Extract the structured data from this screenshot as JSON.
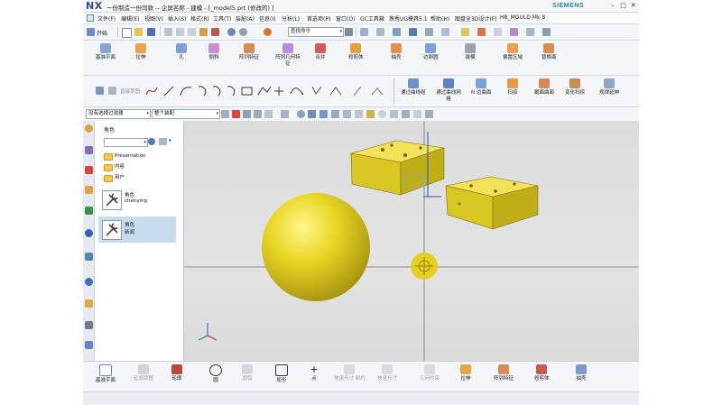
{
  "title_bar": {
    "logo": "NX",
    "title": "一份制造一份同款 -- 企屏名称 - 建模 - [_model5.prt  (修改的) ]",
    "brand": "SIEMENS",
    "minimize": "–",
    "restore": "□",
    "close": "✕"
  },
  "menu": [
    "文件(F)",
    "编辑(E)",
    "视图(V)",
    "插入(S)",
    "格式(R)",
    "工具(T)",
    "装配(A)",
    "信息(I)",
    "分析(L)",
    "首选项(P)",
    "窗口(O)",
    "GC工具箱",
    "燕秀UG模具5.1",
    "帮助(H)",
    "图盘全3D设计(F)",
    "HB_MOULD Mk 8"
  ],
  "toolbar1": {
    "start_label": "开始",
    "command_search_placeholder": "查找命令"
  },
  "toolbar2": [
    {
      "label": "基准平面",
      "icon": "datum-plane-icon",
      "color": "#8aa6cf"
    },
    {
      "label": "拉伸",
      "icon": "extrude-icon",
      "color": "#e7a24a"
    },
    {
      "label": "孔",
      "icon": "hole-icon",
      "color": "#7da0d6"
    },
    {
      "label": "倒斜",
      "icon": "chamfer-icon",
      "color": "#c98dd1"
    },
    {
      "label": "阵列特征",
      "icon": "pattern-feature-icon",
      "color": "#d88a58"
    },
    {
      "label": "阵列几何特征",
      "icon": "pattern-geometry-icon",
      "color": "#b68be0"
    },
    {
      "label": "合并",
      "icon": "unite-icon",
      "color": "#d85a58"
    },
    {
      "label": "修剪体",
      "icon": "trim-body-icon",
      "color": "#e0a146"
    },
    {
      "label": "抽壳",
      "icon": "shell-icon",
      "color": "#e88c4a"
    },
    {
      "label": "边倒圆",
      "icon": "edge-blend-icon",
      "color": "#7aa1d9"
    },
    {
      "label": "拔模",
      "icon": "draft-icon",
      "color": "#9aa0b5"
    },
    {
      "label": "偏置区域",
      "icon": "offset-region-icon",
      "color": "#e5a14e"
    },
    {
      "label": "替换面",
      "icon": "replace-face-icon",
      "color": "#d98c4f"
    }
  ],
  "toolbar3": {
    "section_label": "草图",
    "sketch_group": "直接草图",
    "surface_buttons": [
      {
        "label": "通过曲线组",
        "color": "#6e8fc9"
      },
      {
        "label": "通过曲线网格",
        "color": "#5b84c4"
      },
      {
        "label": "N 边曲面",
        "color": "#7ba1d9"
      },
      {
        "label": "扫掠",
        "color": "#e29a4d"
      },
      {
        "label": "截面曲面",
        "color": "#d58a56"
      },
      {
        "label": "变化扫掠",
        "color": "#c98d51"
      },
      {
        "label": "规律延伸",
        "color": "#8fa6c5"
      }
    ]
  },
  "toolbar4": {
    "selection_filter": "没有选择过滤器",
    "assembly_scope": "整个装配"
  },
  "resource_bar_icons": [
    "part-navigator-icon",
    "assembly-navigator-icon",
    "constraint-navigator-icon",
    "reuse-library-icon",
    "hd3d-tools-icon",
    "web-browser-icon",
    "history-icon",
    "system-materials-icon",
    "roles-icon"
  ],
  "role_panel": {
    "title": "角色",
    "tree": [
      "Presentation",
      "内容",
      "用户"
    ],
    "roles": [
      {
        "name": "角色",
        "sub": "chenying",
        "selected": false
      },
      {
        "name": "角色",
        "sub": "新闻",
        "selected": true
      }
    ]
  },
  "viewport": {
    "sphere_color": "#e6d420",
    "block_color": "#d9c821",
    "crosshair_color": "#e3cf14"
  },
  "bottom_toolbar": [
    {
      "label": "基准平面",
      "icon": "datum-plane-icon",
      "greyed": false
    },
    {
      "label": "轮廓草图",
      "icon": "profile-icon",
      "greyed": true
    },
    {
      "label": "轮廓",
      "icon": "profile-curve-icon",
      "greyed": false
    },
    {
      "label": "圆",
      "icon": "circle-icon",
      "greyed": false
    },
    {
      "label": "圆弧",
      "icon": "arc-icon",
      "greyed": true
    },
    {
      "label": "矩形",
      "icon": "rectangle-icon",
      "greyed": false
    },
    {
      "label": "点",
      "icon": "point-icon",
      "greyed": false
    },
    {
      "label": "快速尺寸 制约",
      "icon": "dimension-icon",
      "greyed": true
    },
    {
      "label": "快速尺寸",
      "icon": "rapid-dimension-icon",
      "greyed": true
    },
    {
      "label": "几何约束",
      "icon": "geometric-constraint-icon",
      "greyed": true
    },
    {
      "label": "拉伸",
      "icon": "extrude-icon",
      "greyed": false
    },
    {
      "label": "阵列特征",
      "icon": "pattern-feature-icon",
      "greyed": false
    },
    {
      "label": "修剪体",
      "icon": "trim-body-icon",
      "greyed": false
    },
    {
      "label": "抽壳",
      "icon": "shell-icon",
      "greyed": false
    }
  ]
}
